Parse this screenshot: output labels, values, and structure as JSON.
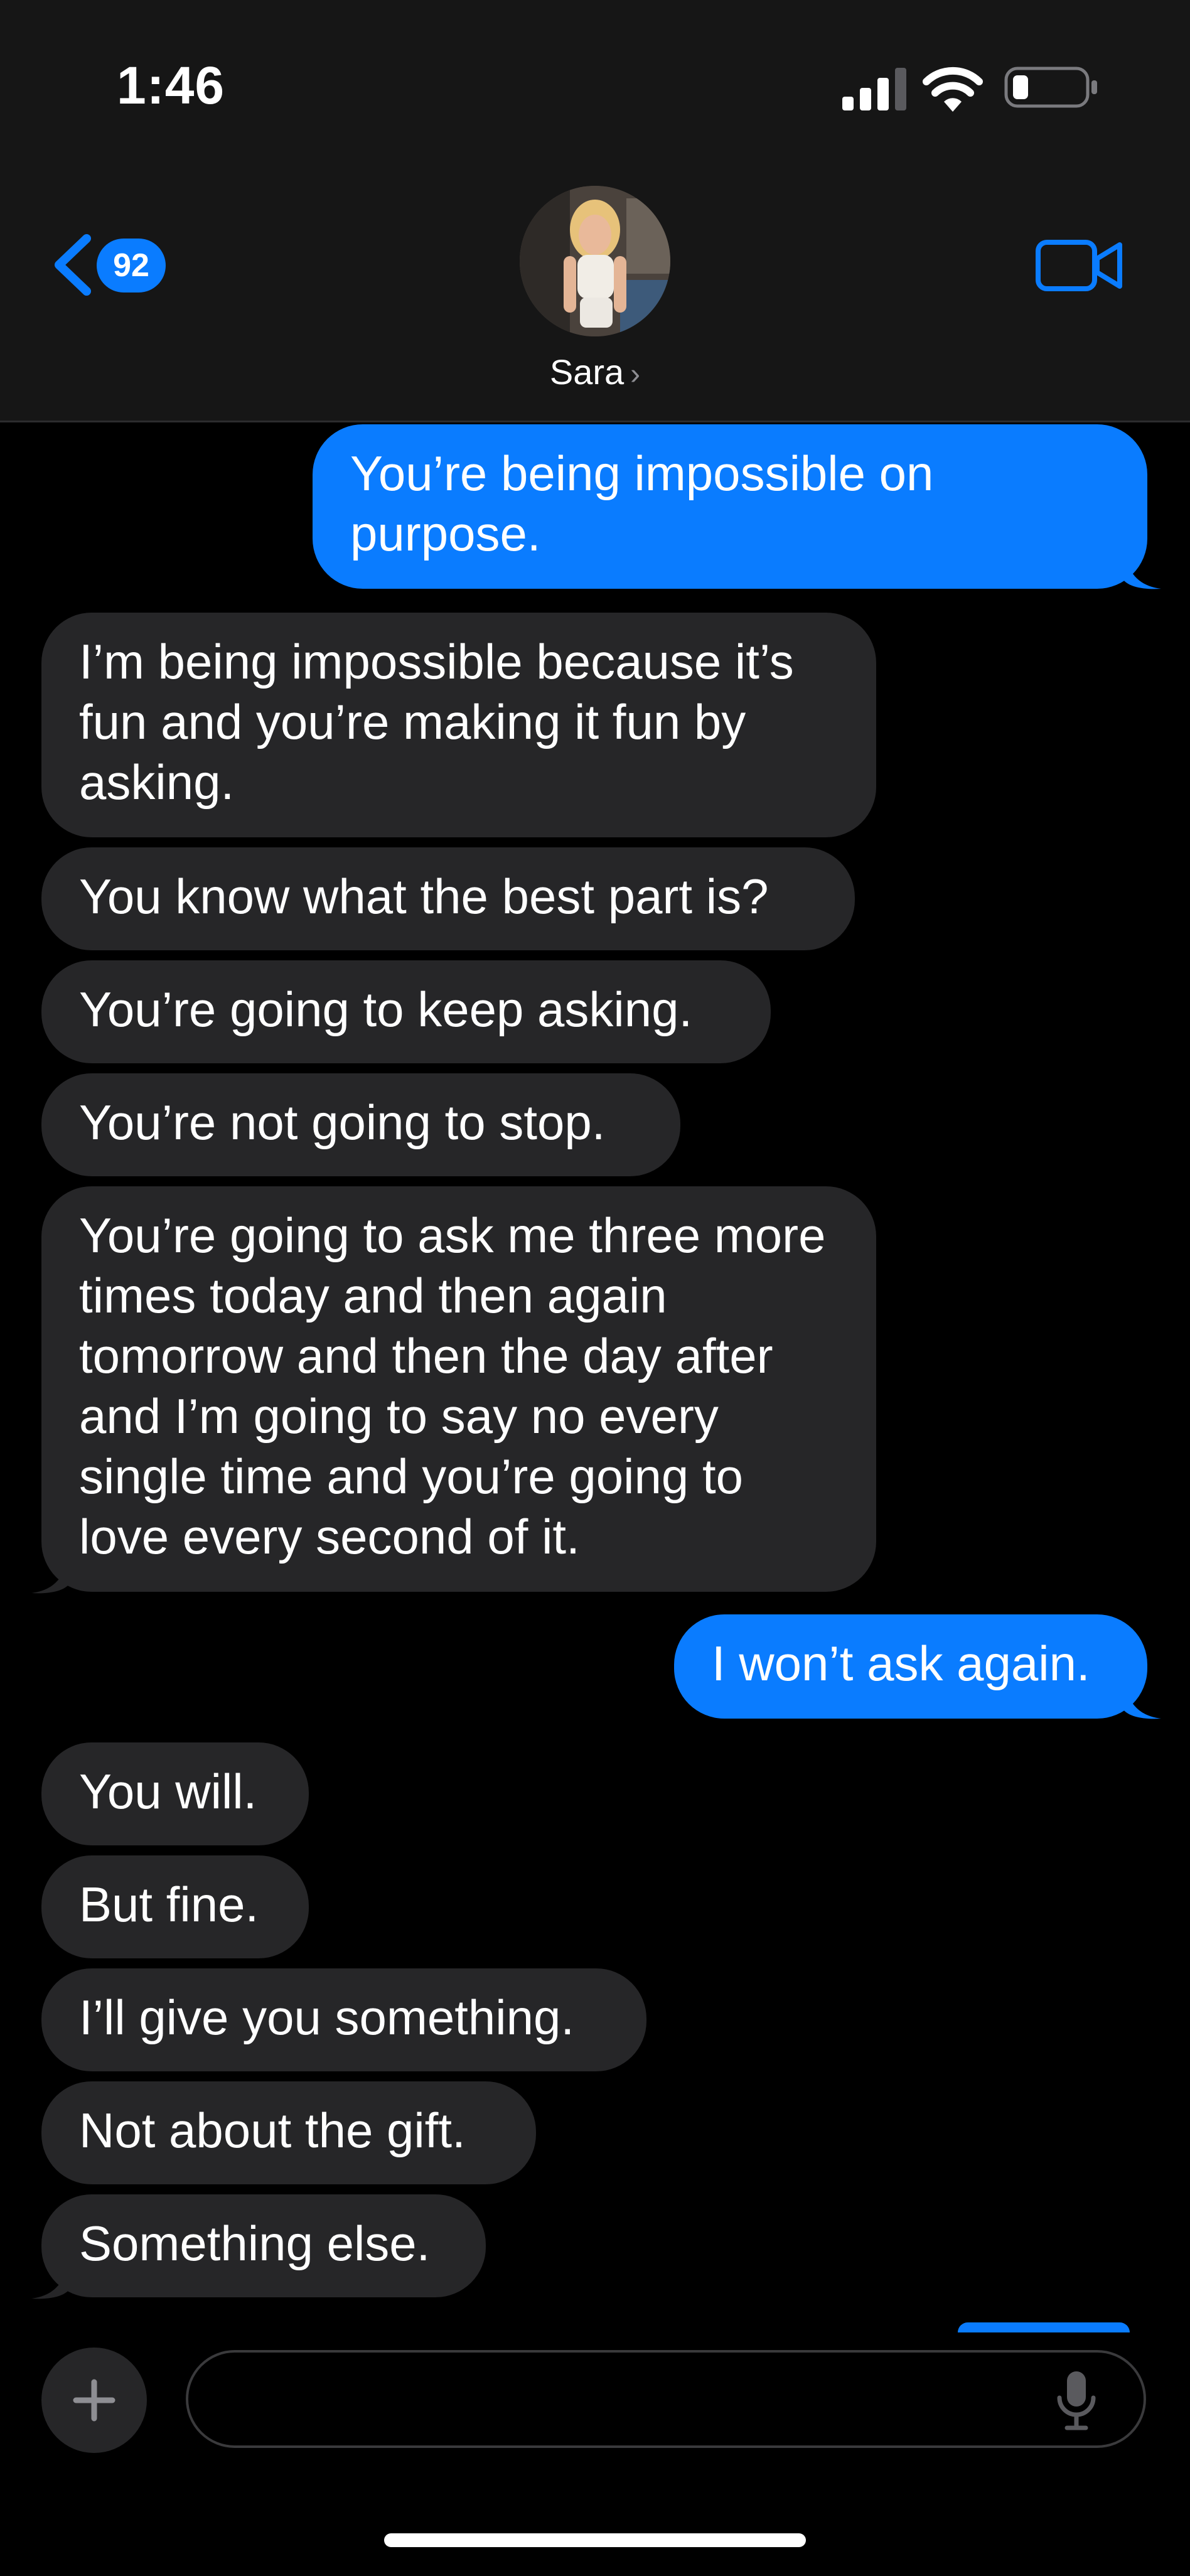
{
  "status_bar": {
    "time": "1:46"
  },
  "header": {
    "unread_count": "92",
    "contact_name": "Sara",
    "name_chevron": "›"
  },
  "messages": [
    {
      "from": "me",
      "text": "You’re being impossible on purpose."
    },
    {
      "from": "them",
      "text": "I’m being impossible because it’s fun and you’re making it fun by asking."
    },
    {
      "from": "them",
      "text": "You know what the best part is?"
    },
    {
      "from": "them",
      "text": "You’re going to keep asking."
    },
    {
      "from": "them",
      "text": "You’re not going to stop."
    },
    {
      "from": "them",
      "text": "You’re going to ask me three more times today and then again tomorrow and then the day after and I’m going to say no every single time and you’re going to love every second of it."
    },
    {
      "from": "me",
      "text": "I won’t ask again."
    },
    {
      "from": "them",
      "text": "You will."
    },
    {
      "from": "them",
      "text": "But fine."
    },
    {
      "from": "them",
      "text": "I’ll give you something."
    },
    {
      "from": "them",
      "text": "Not about the gift."
    },
    {
      "from": "them",
      "text": "Something else."
    }
  ],
  "composer": {
    "placeholder": ""
  },
  "colors": {
    "sent_bubble": "#0a7cff",
    "received_bubble": "#262628",
    "accent": "#0a7cff"
  },
  "icons": [
    "signal-icon",
    "wifi-icon",
    "battery-icon",
    "back-chevron-icon",
    "facetime-video-icon",
    "plus-icon",
    "microphone-icon"
  ]
}
